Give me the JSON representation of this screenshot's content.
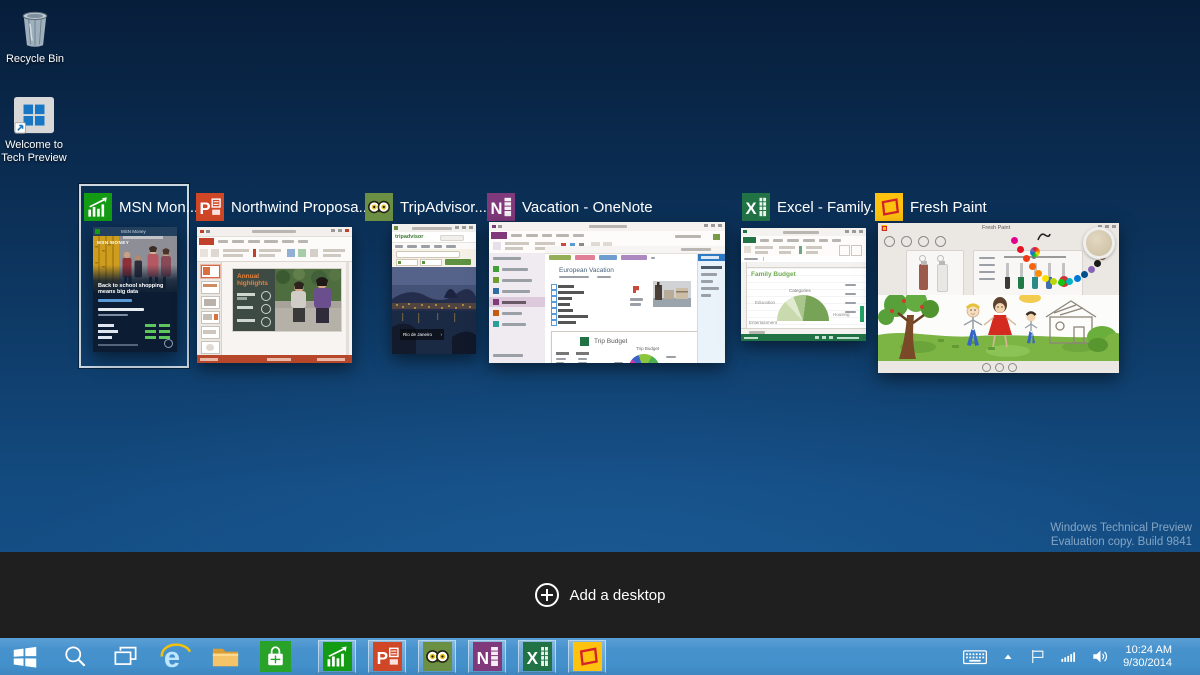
{
  "colors": {
    "taskbar_blue": "#4792cd",
    "desktops_bar": "#1f1f1f",
    "selection_border": "#ccd7e0",
    "desktop_top": "#071e3a",
    "desktop_bottom": "#155289"
  },
  "desktop": {
    "icons": [
      {
        "label": "Recycle Bin"
      },
      {
        "label": "Welcome to Tech Preview"
      }
    ],
    "watermark": {
      "line1": "Windows Technical Preview",
      "line2": "Evaluation copy. Build 9841"
    }
  },
  "task_view": {
    "add_desktop_label": "Add a desktop",
    "windows": [
      {
        "title": "MSN Mon...",
        "app": "MSN Money",
        "selected": true
      },
      {
        "title": "Northwind Proposa...",
        "app": "PowerPoint",
        "selected": false
      },
      {
        "title": "TripAdvisor...",
        "app": "TripAdvisor",
        "selected": false
      },
      {
        "title": "Vacation - OneNote",
        "app": "OneNote",
        "selected": false
      },
      {
        "title": "Excel - Family...",
        "app": "Excel",
        "selected": false
      },
      {
        "title": "Fresh Paint",
        "app": "Fresh Paint",
        "selected": false
      }
    ]
  },
  "thumbnails": {
    "msn": {
      "window_title": "MSN Money",
      "brand": "MSN MONEY",
      "headline": "Back to school shopping means big data"
    },
    "powerpoint": {
      "slide_title": "Annual highlights"
    },
    "tripadvisor": {
      "logo": "tripadvisor",
      "photo_label": "Rio de Janeiro"
    },
    "onenote": {
      "page_title": "European Vacation",
      "card_title": "Trip Budget",
      "chart_title": "Trip Budget"
    },
    "excel": {
      "sheet_title": "Family Budget",
      "chart_title": "Categories",
      "label_left": "Education",
      "label_right": "Housing",
      "label_bottom": "Entertainment"
    },
    "freshpaint": {
      "window_title": "Fresh Paint"
    }
  },
  "taskbar": {
    "buttons": [
      "start",
      "search",
      "task-view",
      "internet-explorer",
      "file-explorer",
      "store"
    ],
    "running_apps": [
      "MSN Money",
      "PowerPoint",
      "TripAdvisor",
      "OneNote",
      "Excel",
      "Fresh Paint"
    ],
    "tray": {
      "time": "10:24 AM",
      "date": "9/30/2014"
    }
  }
}
